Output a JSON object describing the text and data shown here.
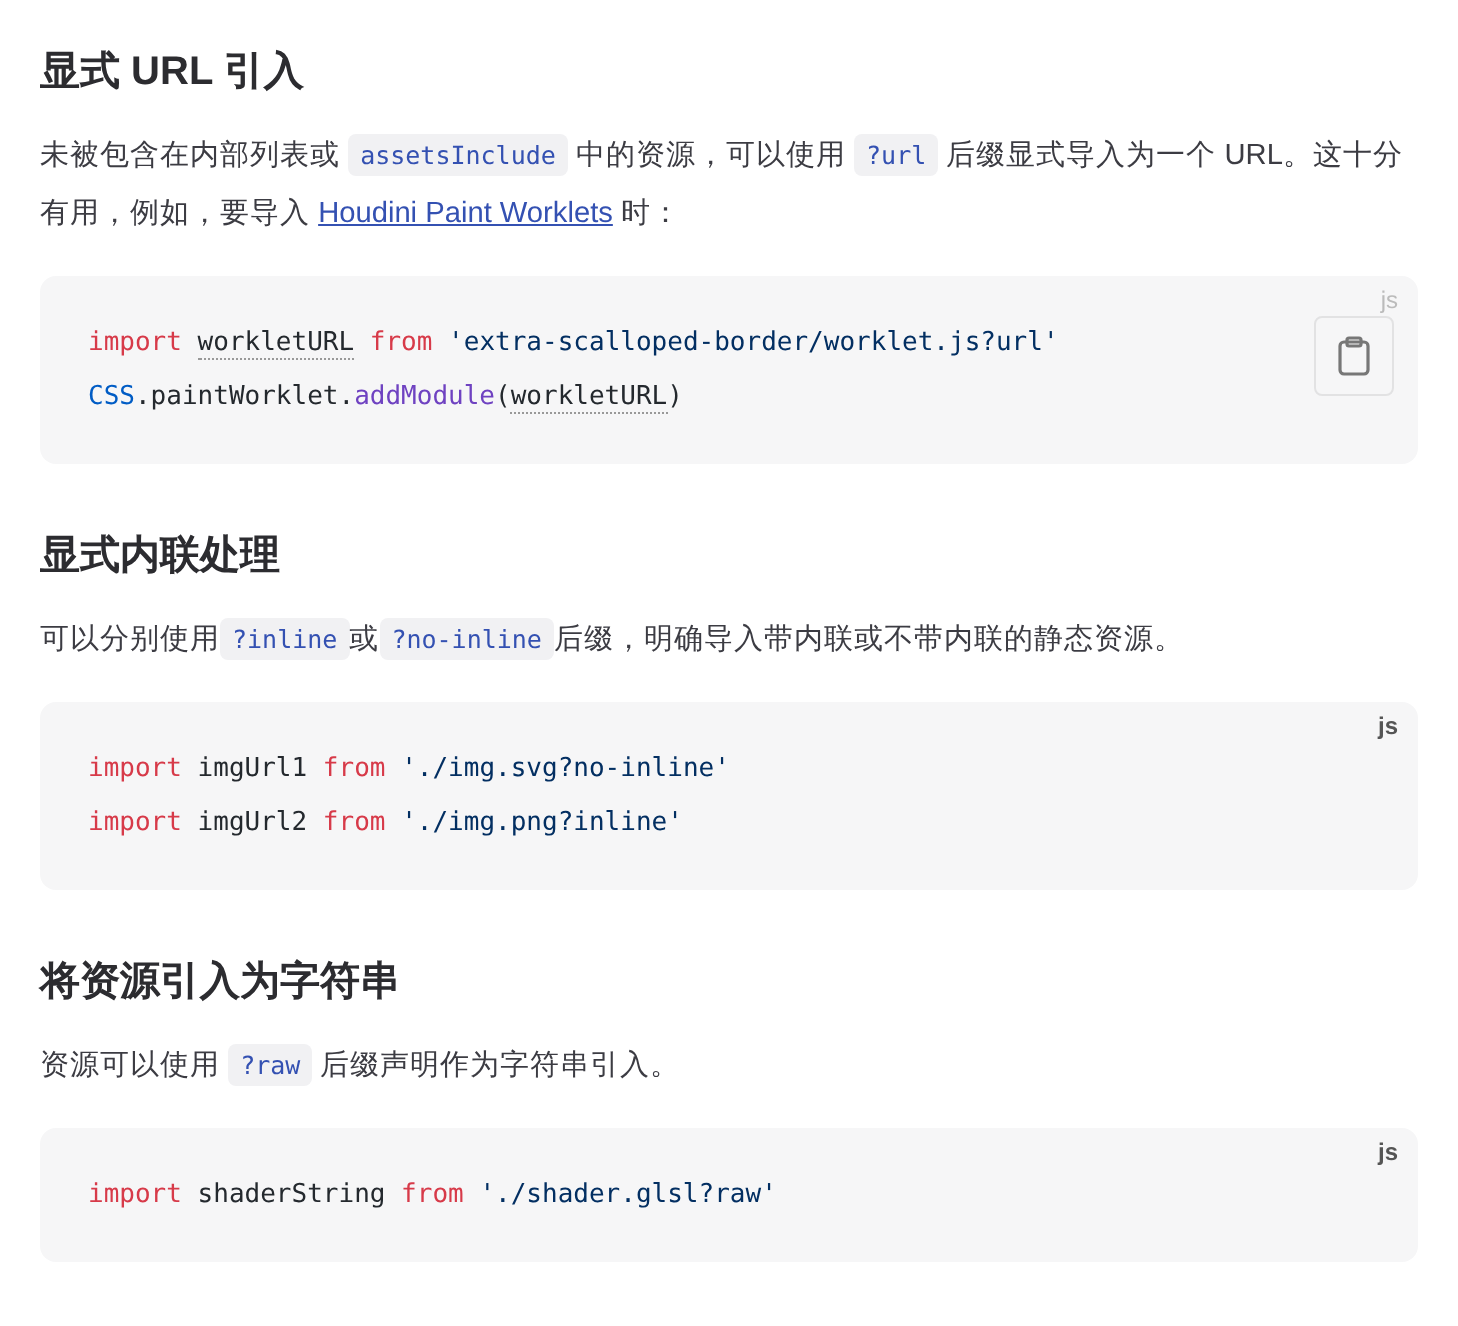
{
  "sections": [
    {
      "heading": "显式 URL 引入",
      "paragraphs": [
        [
          {
            "kind": "text",
            "text": "未被包含在内部列表或 "
          },
          {
            "kind": "code",
            "text": "assetsInclude"
          },
          {
            "kind": "text",
            "text": " 中的资源，可以使用 "
          },
          {
            "kind": "code",
            "text": "?url"
          },
          {
            "kind": "text",
            "text": " 后缀显式导入为一个 URL。这十分有用，例如，要导入 "
          },
          {
            "kind": "link",
            "text": "Houdini Paint Worklets"
          },
          {
            "kind": "text",
            "text": " 时："
          }
        ]
      ],
      "code": {
        "lang": "js",
        "copy_button_shown": true,
        "lines": [
          [
            {
              "kind": "keyword",
              "text": "import "
            },
            {
              "kind": "ref",
              "text": "workletURL"
            },
            {
              "kind": "keyword",
              "text": " from "
            },
            {
              "kind": "string",
              "text": "'extra-scalloped-border/worklet.js?url'"
            }
          ],
          [
            {
              "kind": "builtin",
              "text": "CSS"
            },
            {
              "kind": "plain",
              "text": ".paintWorklet."
            },
            {
              "kind": "func",
              "text": "addModule"
            },
            {
              "kind": "plain",
              "text": "("
            },
            {
              "kind": "ref",
              "text": "workletURL"
            },
            {
              "kind": "plain",
              "text": ")"
            }
          ]
        ]
      }
    },
    {
      "heading": "显式内联处理",
      "paragraphs": [
        [
          {
            "kind": "text",
            "text": "可以分别使用"
          },
          {
            "kind": "code",
            "text": "?inline"
          },
          {
            "kind": "text",
            "text": "或"
          },
          {
            "kind": "code",
            "text": "?no-inline"
          },
          {
            "kind": "text",
            "text": "后缀，明确导入带内联或不带内联的静态资源。"
          }
        ]
      ],
      "code": {
        "lang": "js",
        "copy_button_shown": false,
        "lines": [
          [
            {
              "kind": "keyword",
              "text": "import "
            },
            {
              "kind": "plain",
              "text": "imgUrl1 "
            },
            {
              "kind": "keyword",
              "text": "from "
            },
            {
              "kind": "string",
              "text": "'./img.svg?no-inline'"
            }
          ],
          [
            {
              "kind": "keyword",
              "text": "import "
            },
            {
              "kind": "plain",
              "text": "imgUrl2 "
            },
            {
              "kind": "keyword",
              "text": "from "
            },
            {
              "kind": "string",
              "text": "'./img.png?inline'"
            }
          ]
        ]
      }
    },
    {
      "heading": "将资源引入为字符串",
      "paragraphs": [
        [
          {
            "kind": "text",
            "text": "资源可以使用 "
          },
          {
            "kind": "code",
            "text": "?raw"
          },
          {
            "kind": "text",
            "text": " 后缀声明作为字符串引入。"
          }
        ]
      ],
      "code": {
        "lang": "js",
        "copy_button_shown": false,
        "lines": [
          [
            {
              "kind": "keyword",
              "text": "import "
            },
            {
              "kind": "plain",
              "text": "shaderString "
            },
            {
              "kind": "keyword",
              "text": "from "
            },
            {
              "kind": "string",
              "text": "'./shader.glsl?raw'"
            }
          ]
        ]
      }
    }
  ]
}
